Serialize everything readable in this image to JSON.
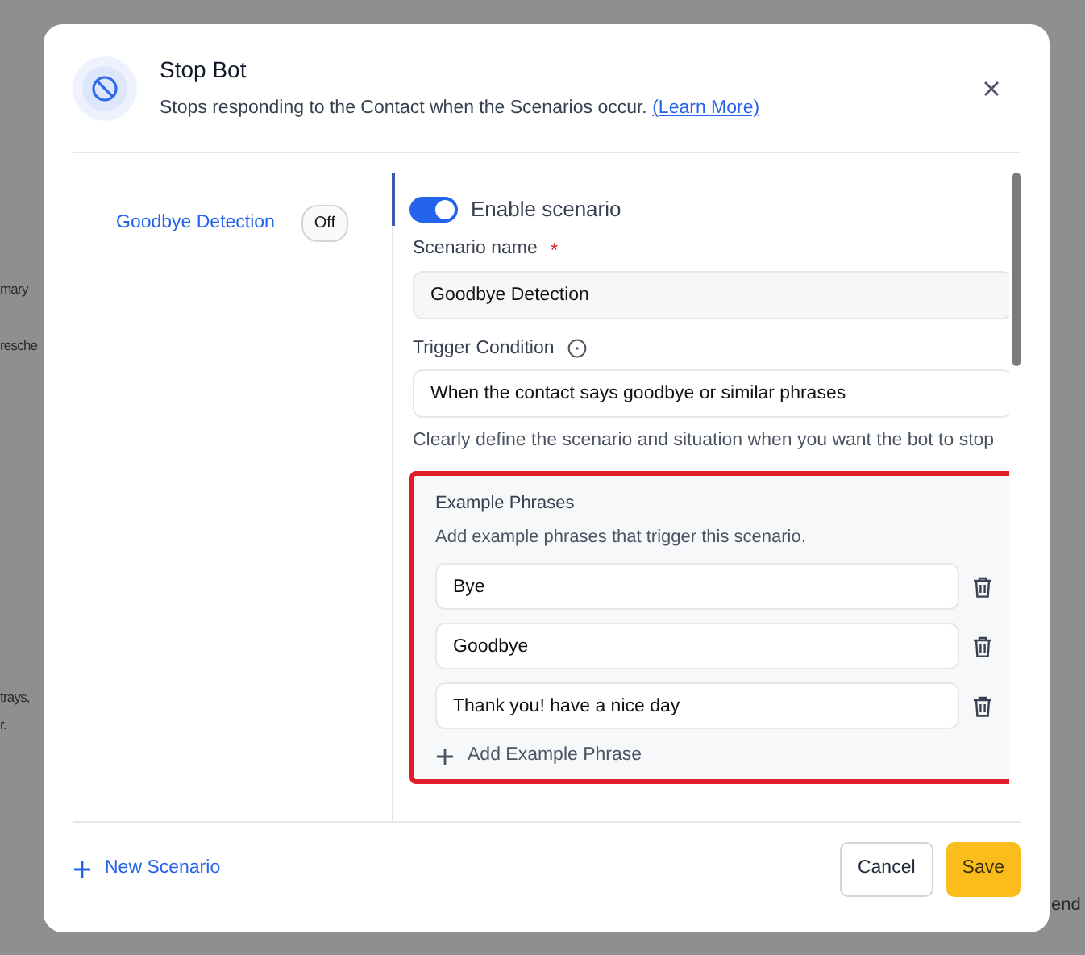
{
  "background": {
    "left_fragments": [
      "mary",
      "resche",
      "trays,",
      "r."
    ],
    "right_fragments": [
      "end"
    ]
  },
  "dialog": {
    "title": "Stop Bot",
    "description": "Stops responding to the Contact when the Scenarios occur.",
    "learn_more": "(Learn More)"
  },
  "scenarios": [
    {
      "name": "Goodbye Detection",
      "status": "Off",
      "selected": true
    }
  ],
  "editor": {
    "enabled": true,
    "enable_label": "Enable scenario",
    "name_label": "Scenario name",
    "required_mark": "*",
    "name_value": "Goodbye Detection",
    "trigger_label": "Trigger Condition",
    "trigger_value": "When the contact says goodbye or similar phrases",
    "trigger_hint": "Clearly define the scenario and situation when you want the bot to stop",
    "examples": {
      "highlighted": true,
      "title": "Example Phrases",
      "description": "Add example phrases that trigger this scenario.",
      "phrases": [
        "Bye",
        "Goodbye",
        "Thank you! have a nice day"
      ],
      "add_label": "Add Example Phrase"
    }
  },
  "footer": {
    "new_scenario": "New Scenario",
    "cancel": "Cancel",
    "save": "Save"
  }
}
